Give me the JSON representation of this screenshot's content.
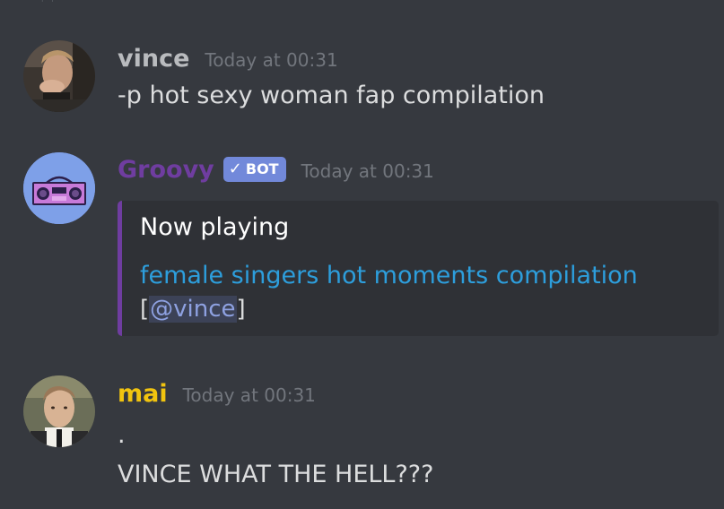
{
  "colors": {
    "background": "#36393f",
    "embed_background": "#2f3136",
    "embed_border": "#6f3da0",
    "bot_badge": "#7289da",
    "link": "#2d9edc",
    "mention": "#8ea1e1"
  },
  "messages": [
    {
      "username": "vince",
      "username_color": "#b9bbbe",
      "timestamp": "Today at 00:31",
      "content": "-p hot sexy woman fap compilation"
    },
    {
      "username": "Groovy",
      "username_color": "#6f3da0",
      "bot_badge": "BOT",
      "bot_check": "✓",
      "timestamp": "Today at 00:31",
      "embed": {
        "title": "Now playing",
        "link_text": "female singers hot moments compilation",
        "requester_open": "[",
        "requester_mention": "@vince",
        "requester_close": "]"
      }
    },
    {
      "username": "mai",
      "username_color": "#f1c40f",
      "timestamp": "Today at 00:31",
      "content_line_1": ".",
      "content_line_2": "VINCE WHAT THE HELL???"
    }
  ]
}
